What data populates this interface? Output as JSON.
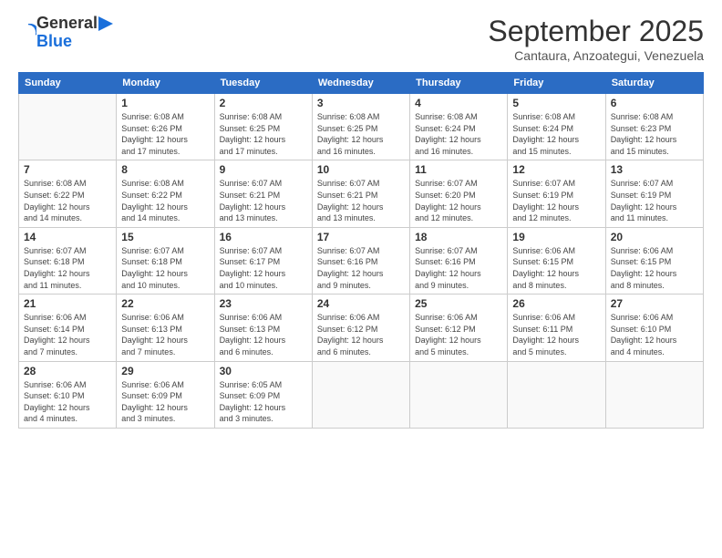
{
  "header": {
    "logo": {
      "line1": "General",
      "line2": "Blue"
    },
    "title": "September 2025",
    "subtitle": "Cantaura, Anzoategui, Venezuela"
  },
  "weekdays": [
    "Sunday",
    "Monday",
    "Tuesday",
    "Wednesday",
    "Thursday",
    "Friday",
    "Saturday"
  ],
  "weeks": [
    [
      {
        "day": "",
        "info": ""
      },
      {
        "day": "1",
        "info": "Sunrise: 6:08 AM\nSunset: 6:26 PM\nDaylight: 12 hours\nand 17 minutes."
      },
      {
        "day": "2",
        "info": "Sunrise: 6:08 AM\nSunset: 6:25 PM\nDaylight: 12 hours\nand 17 minutes."
      },
      {
        "day": "3",
        "info": "Sunrise: 6:08 AM\nSunset: 6:25 PM\nDaylight: 12 hours\nand 16 minutes."
      },
      {
        "day": "4",
        "info": "Sunrise: 6:08 AM\nSunset: 6:24 PM\nDaylight: 12 hours\nand 16 minutes."
      },
      {
        "day": "5",
        "info": "Sunrise: 6:08 AM\nSunset: 6:24 PM\nDaylight: 12 hours\nand 15 minutes."
      },
      {
        "day": "6",
        "info": "Sunrise: 6:08 AM\nSunset: 6:23 PM\nDaylight: 12 hours\nand 15 minutes."
      }
    ],
    [
      {
        "day": "7",
        "info": "Sunrise: 6:08 AM\nSunset: 6:22 PM\nDaylight: 12 hours\nand 14 minutes."
      },
      {
        "day": "8",
        "info": "Sunrise: 6:08 AM\nSunset: 6:22 PM\nDaylight: 12 hours\nand 14 minutes."
      },
      {
        "day": "9",
        "info": "Sunrise: 6:07 AM\nSunset: 6:21 PM\nDaylight: 12 hours\nand 13 minutes."
      },
      {
        "day": "10",
        "info": "Sunrise: 6:07 AM\nSunset: 6:21 PM\nDaylight: 12 hours\nand 13 minutes."
      },
      {
        "day": "11",
        "info": "Sunrise: 6:07 AM\nSunset: 6:20 PM\nDaylight: 12 hours\nand 12 minutes."
      },
      {
        "day": "12",
        "info": "Sunrise: 6:07 AM\nSunset: 6:19 PM\nDaylight: 12 hours\nand 12 minutes."
      },
      {
        "day": "13",
        "info": "Sunrise: 6:07 AM\nSunset: 6:19 PM\nDaylight: 12 hours\nand 11 minutes."
      }
    ],
    [
      {
        "day": "14",
        "info": "Sunrise: 6:07 AM\nSunset: 6:18 PM\nDaylight: 12 hours\nand 11 minutes."
      },
      {
        "day": "15",
        "info": "Sunrise: 6:07 AM\nSunset: 6:18 PM\nDaylight: 12 hours\nand 10 minutes."
      },
      {
        "day": "16",
        "info": "Sunrise: 6:07 AM\nSunset: 6:17 PM\nDaylight: 12 hours\nand 10 minutes."
      },
      {
        "day": "17",
        "info": "Sunrise: 6:07 AM\nSunset: 6:16 PM\nDaylight: 12 hours\nand 9 minutes."
      },
      {
        "day": "18",
        "info": "Sunrise: 6:07 AM\nSunset: 6:16 PM\nDaylight: 12 hours\nand 9 minutes."
      },
      {
        "day": "19",
        "info": "Sunrise: 6:06 AM\nSunset: 6:15 PM\nDaylight: 12 hours\nand 8 minutes."
      },
      {
        "day": "20",
        "info": "Sunrise: 6:06 AM\nSunset: 6:15 PM\nDaylight: 12 hours\nand 8 minutes."
      }
    ],
    [
      {
        "day": "21",
        "info": "Sunrise: 6:06 AM\nSunset: 6:14 PM\nDaylight: 12 hours\nand 7 minutes."
      },
      {
        "day": "22",
        "info": "Sunrise: 6:06 AM\nSunset: 6:13 PM\nDaylight: 12 hours\nand 7 minutes."
      },
      {
        "day": "23",
        "info": "Sunrise: 6:06 AM\nSunset: 6:13 PM\nDaylight: 12 hours\nand 6 minutes."
      },
      {
        "day": "24",
        "info": "Sunrise: 6:06 AM\nSunset: 6:12 PM\nDaylight: 12 hours\nand 6 minutes."
      },
      {
        "day": "25",
        "info": "Sunrise: 6:06 AM\nSunset: 6:12 PM\nDaylight: 12 hours\nand 5 minutes."
      },
      {
        "day": "26",
        "info": "Sunrise: 6:06 AM\nSunset: 6:11 PM\nDaylight: 12 hours\nand 5 minutes."
      },
      {
        "day": "27",
        "info": "Sunrise: 6:06 AM\nSunset: 6:10 PM\nDaylight: 12 hours\nand 4 minutes."
      }
    ],
    [
      {
        "day": "28",
        "info": "Sunrise: 6:06 AM\nSunset: 6:10 PM\nDaylight: 12 hours\nand 4 minutes."
      },
      {
        "day": "29",
        "info": "Sunrise: 6:06 AM\nSunset: 6:09 PM\nDaylight: 12 hours\nand 3 minutes."
      },
      {
        "day": "30",
        "info": "Sunrise: 6:05 AM\nSunset: 6:09 PM\nDaylight: 12 hours\nand 3 minutes."
      },
      {
        "day": "",
        "info": ""
      },
      {
        "day": "",
        "info": ""
      },
      {
        "day": "",
        "info": ""
      },
      {
        "day": "",
        "info": ""
      }
    ]
  ]
}
